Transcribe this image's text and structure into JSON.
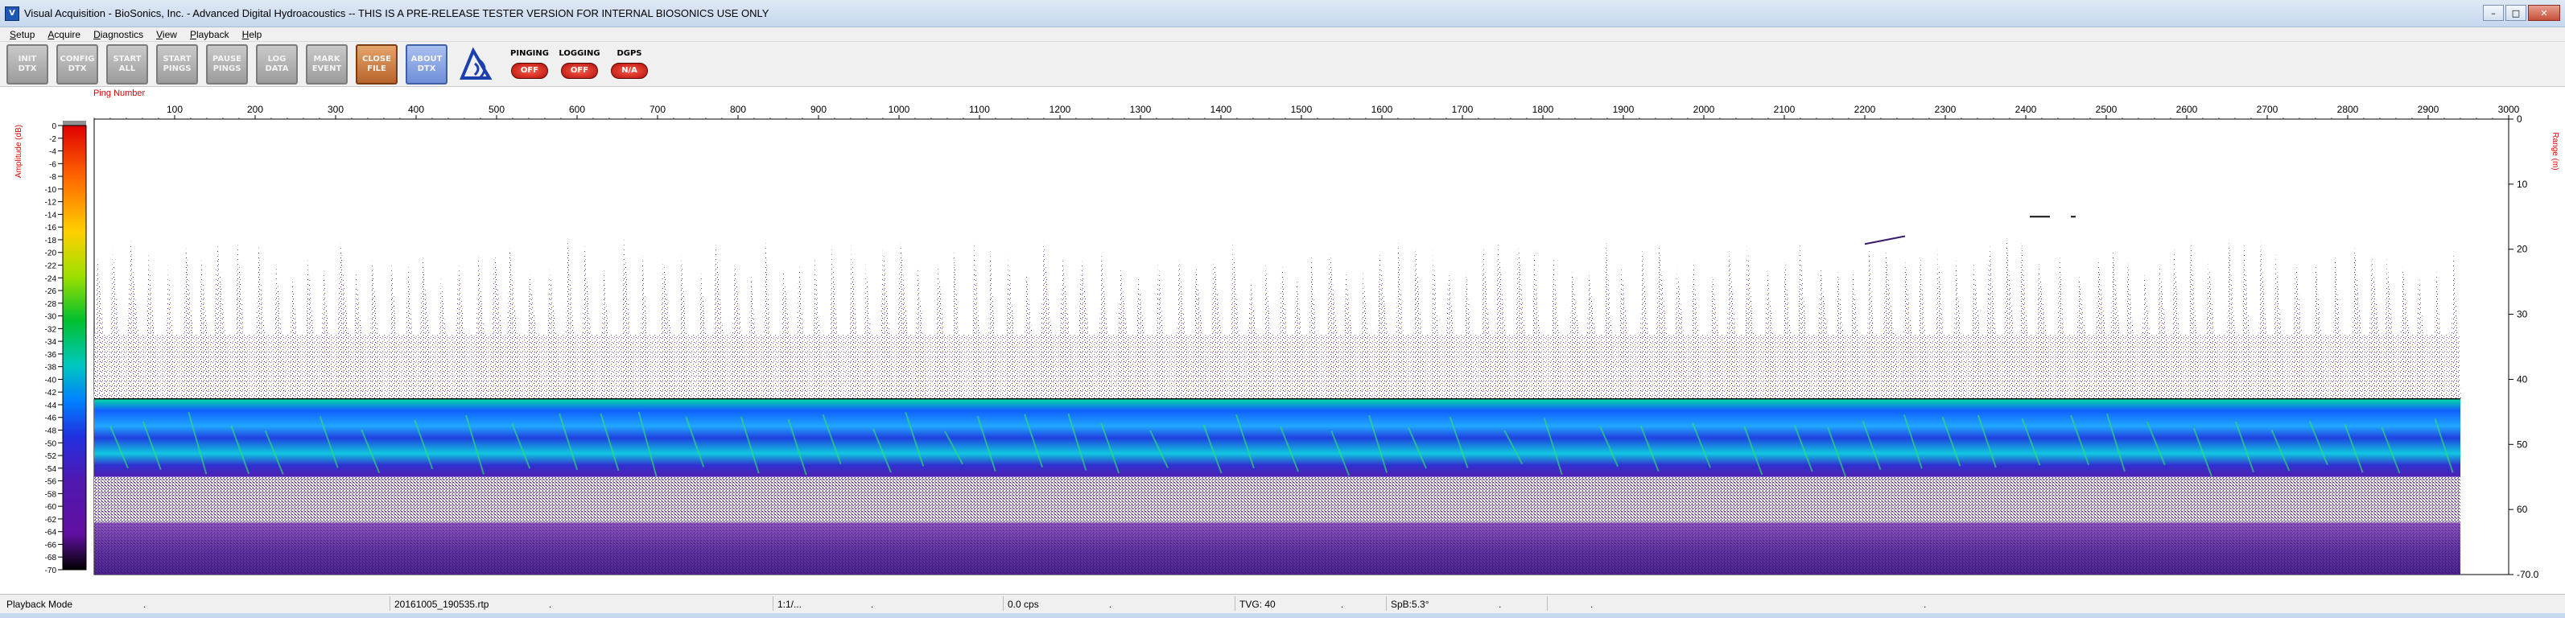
{
  "window": {
    "title": "Visual Acquisition  -  BioSonics, Inc.  -  Advanced Digital Hydroacoustics  -- THIS IS A PRE-RELEASE TESTER VERSION FOR INTERNAL BIOSONICS USE ONLY",
    "minimize": "–",
    "maximize": "□",
    "close": "✕"
  },
  "menu": [
    "Setup",
    "Acquire",
    "Diagnostics",
    "View",
    "Playback",
    "Help"
  ],
  "toolbar": {
    "buttons": [
      {
        "name": "init-dtx-button",
        "label": "INIT\nDTX",
        "style": "gray"
      },
      {
        "name": "config-dtx-button",
        "label": "CONFIG\nDTX",
        "style": "gray"
      },
      {
        "name": "start-all-button",
        "label": "START\nALL",
        "style": "gray"
      },
      {
        "name": "start-pings-button",
        "label": "START\nPINGS",
        "style": "gray"
      },
      {
        "name": "pause-pings-button",
        "label": "PAUSE\nPINGS",
        "style": "gray"
      },
      {
        "name": "log-data-button",
        "label": "LOG\nDATA",
        "style": "gray"
      },
      {
        "name": "mark-event-button",
        "label": "MARK\nEVENT",
        "style": "gray"
      },
      {
        "name": "close-file-button",
        "label": "CLOSE\nFILE",
        "style": "orange"
      },
      {
        "name": "about-dtx-button",
        "label": "ABOUT\nDTX",
        "style": "blue"
      }
    ],
    "indicators": [
      {
        "name": "pinging-indicator",
        "label": "PINGING",
        "value": "OFF"
      },
      {
        "name": "logging-indicator",
        "label": "LOGGING",
        "value": "OFF"
      },
      {
        "name": "dgps-indicator",
        "label": "DGPS",
        "value": "N/A"
      }
    ]
  },
  "chart_data": {
    "type": "heatmap",
    "title": "",
    "xlabel": "Ping Number",
    "ylabel_left": "Amplitude (dB)",
    "ylabel_right": "Range (m)",
    "x_ticks": [
      100,
      200,
      300,
      400,
      500,
      600,
      700,
      800,
      900,
      1000,
      1100,
      1200,
      1300,
      1400,
      1500,
      1600,
      1700,
      1800,
      1900,
      2000,
      2100,
      2200,
      2300,
      2400,
      2500,
      2600,
      2700,
      2800,
      2900,
      3000
    ],
    "xlim": [
      0,
      3000
    ],
    "range_ticks": [
      "0",
      "10",
      "20",
      "30",
      "40",
      "50",
      "60",
      "-70.0"
    ],
    "ylim_m": [
      0,
      70
    ],
    "amplitude_ticks": [
      "0",
      "-2",
      "-4",
      "-6",
      "-8",
      "-10",
      "-12",
      "-14",
      "-16",
      "-18",
      "-20",
      "-22",
      "-24",
      "-26",
      "-28",
      "-30",
      "-32",
      "-34",
      "-36",
      "-38",
      "-40",
      "-42",
      "-44",
      "-46",
      "-48",
      "-50",
      "-52",
      "-54",
      "-56",
      "-58",
      "-60",
      "-62",
      "-64",
      "-66",
      "-68",
      "-70"
    ],
    "amplitude_range_db": [
      -70,
      0
    ],
    "data_pings": [
      0,
      2940
    ],
    "bottom_depth_m": 43,
    "bottom_band_m": [
      43,
      55
    ],
    "colors": {
      "scale": [
        "#ffffff",
        "#e00000",
        "#ff6a00",
        "#ffd000",
        "#9de000",
        "#00c030",
        "#00c8c0",
        "#0080ff",
        "#2030e0",
        "#5018b0",
        "#6010a0",
        "#000000"
      ],
      "axis_label": "#e00000"
    }
  },
  "statusbar": {
    "mode": "Playback Mode",
    "dot1": ".",
    "file": "20161005_190535.rtp",
    "dot2": ".",
    "ratio": "1:1/...",
    "dot3": ".",
    "cps": "0.0 cps",
    "dot4": ".",
    "tvg": "TVG: 40",
    "dot5": ".",
    "sp": "SpB:5.3°",
    "dot6": ".",
    "dot7": ".",
    "dot8": "."
  }
}
